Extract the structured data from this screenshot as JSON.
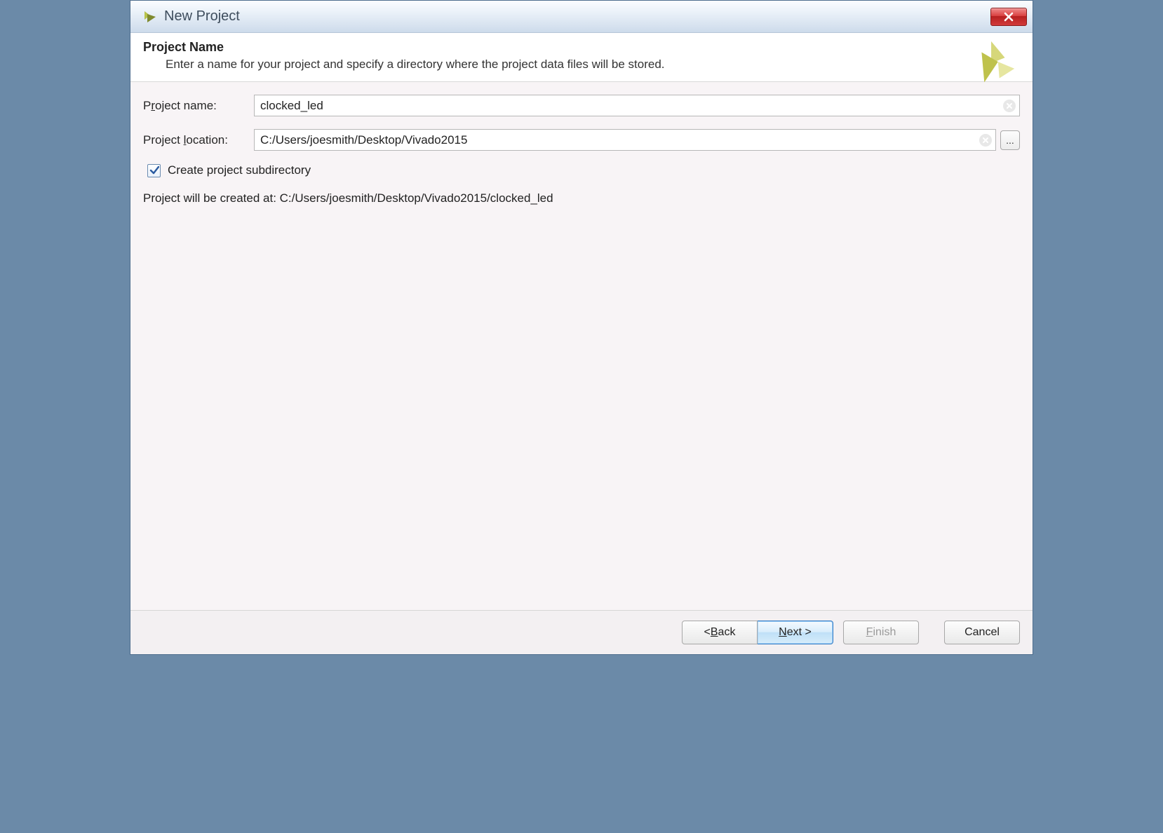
{
  "window": {
    "title": "New Project"
  },
  "header": {
    "title": "Project Name",
    "description": "Enter a name for your project and specify a directory where the project data files will be stored."
  },
  "form": {
    "name_label_pre": "P",
    "name_label_ul": "r",
    "name_label_post": "oject name:",
    "name_value": "clocked_led",
    "location_label_pre": "Project ",
    "location_label_ul": "l",
    "location_label_post": "ocation:",
    "location_value": "C:/Users/joesmith/Desktop/Vivado2015",
    "browse_label": "...",
    "checkbox_label": "Create project subdirectory",
    "checkbox_checked": true,
    "status_text": "Project will be created at: C:/Users/joesmith/Desktop/Vivado2015/clocked_led"
  },
  "footer": {
    "back_pre": "< ",
    "back_ul": "B",
    "back_post": "ack",
    "next_ul": "N",
    "next_post": "ext >",
    "finish_ul": "F",
    "finish_post": "inish",
    "cancel": "Cancel"
  }
}
